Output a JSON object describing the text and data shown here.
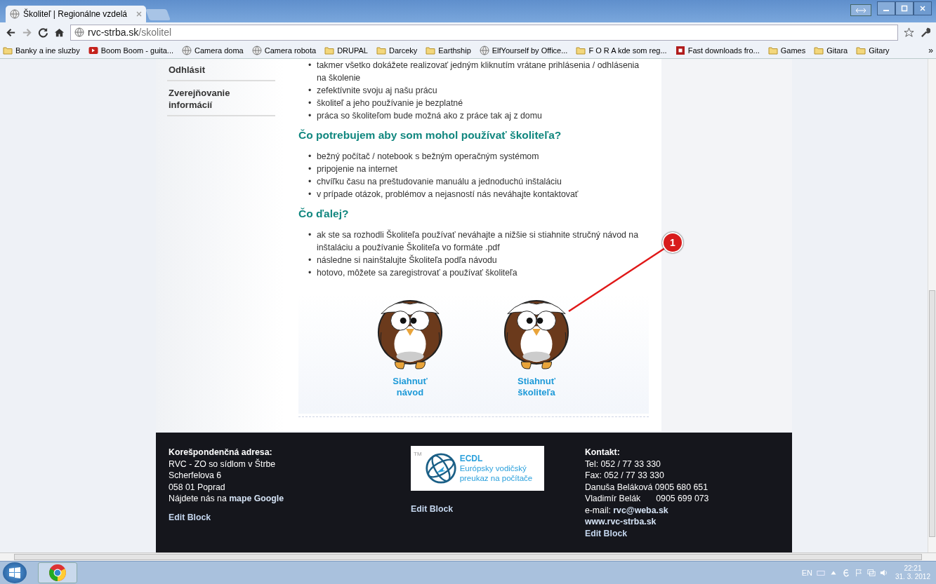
{
  "browser": {
    "tab_title": "Školiteľ | Regionálne vzdelá",
    "url_host": "rvc-strba.sk",
    "url_path": "/skolitel",
    "bookmarks": [
      {
        "label": "Banky a ine sluzby",
        "kind": "folder"
      },
      {
        "label": "Boom Boom - guita...",
        "kind": "video"
      },
      {
        "label": "Camera doma",
        "kind": "globe"
      },
      {
        "label": "Camera robota",
        "kind": "globe"
      },
      {
        "label": "DRUPAL",
        "kind": "folder"
      },
      {
        "label": "Darceky",
        "kind": "folder"
      },
      {
        "label": "Earthship",
        "kind": "folder"
      },
      {
        "label": "ElfYourself by Office...",
        "kind": "globe"
      },
      {
        "label": "F O R A kde som reg...",
        "kind": "folder"
      },
      {
        "label": "Fast downloads fro...",
        "kind": "square"
      },
      {
        "label": "Games",
        "kind": "folder"
      },
      {
        "label": "Gitara",
        "kind": "folder"
      },
      {
        "label": "Gitary",
        "kind": "folder"
      }
    ],
    "overflow": "»"
  },
  "bullet": "•",
  "sidebar": {
    "items": [
      "Odhlásit",
      "Zverejňovanie informácií"
    ]
  },
  "sections": [
    {
      "items": [
        "takmer všetko dokážete realizovať jedným kliknutím vrátane prihlásenia / odhlásenia na školenie",
        "zefektívnite svoju aj našu prácu",
        "školiteľ a jeho používanie je bezplatné",
        "práca so školiteľom bude možná ako z práce tak aj z domu"
      ]
    },
    {
      "heading": "Čo potrebujem aby som mohol používať školiteľa?",
      "items": [
        "bežný počítač / notebook s bežným operačným systémom",
        "pripojenie na internet",
        "chvíľku času na preštudovanie manuálu a jednoduchú inštaláciu",
        "v prípade otázok, problémov a nejasností nás neváhajte kontaktovať"
      ]
    },
    {
      "heading": "Čo ďalej?",
      "items": [
        "ak ste sa rozhodli Školiteľa používať neváhajte a nižšie si stiahnite stručný návod na inštaláciu a používanie Školiteľa vo formáte .pdf",
        "následne si nainštalujte Školiteľa podľa návodu",
        "hotovo, môžete sa zaregistrovať a používať školiteľa"
      ]
    }
  ],
  "downloads": [
    {
      "line1": "Siahnuť",
      "line2": "návod"
    },
    {
      "line1": "Stiahnuť",
      "line2": "školiteľa"
    }
  ],
  "annotation": {
    "number": "1"
  },
  "footer": {
    "address": {
      "heading": "Korešpondenčná adresa:",
      "lines": [
        "RVC - ZO so sídlom v Štrbe",
        "Scherfelova 6",
        "058 01 Poprad"
      ],
      "map_text": "Nájdete nás na",
      "map_link": "mape Google",
      "edit": "Edit Block"
    },
    "logo": {
      "tm": "TM",
      "title": "ECDL",
      "line1": "Európsky vodičský",
      "line2": "preukaz na počítače"
    },
    "center_edit": "Edit Block",
    "contact": {
      "heading": "Kontakt:",
      "lines": [
        "Tel: 052 / 77 33 330",
        "Fax: 052 / 77 33 330",
        "Danuša Beláková 0905 680 651"
      ],
      "person": "Vladimír Belák",
      "person_phone": "0905 699 073",
      "email_label": "e-mail:",
      "email": "rvc@weba.sk",
      "web": "www.rvc-strba.sk",
      "edit": "Edit Block"
    }
  },
  "taskbar": {
    "lang": "EN",
    "time": "22:21",
    "date": "31. 3. 2012"
  }
}
